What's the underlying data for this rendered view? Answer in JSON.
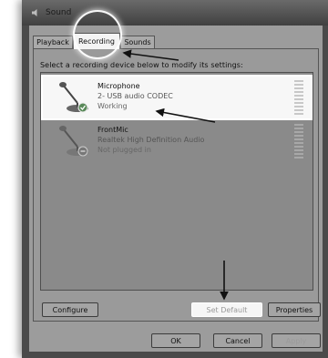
{
  "window": {
    "title": "Sound"
  },
  "tabs": [
    {
      "label": "Playback"
    },
    {
      "label": "Recording"
    },
    {
      "label": "Sounds"
    }
  ],
  "instruction": "Select a recording device below to modify its settings:",
  "devices": [
    {
      "name": "Microphone",
      "description": "2- USB audio CODEC",
      "status": "Working",
      "selected": true
    },
    {
      "name": "FrontMic",
      "description": "Realtek High Definition Audio",
      "status": "Not plugged in",
      "selected": false
    }
  ],
  "buttons": {
    "configure": "Configure",
    "set_default": "Set Default",
    "properties": "Properties",
    "ok": "OK",
    "cancel": "Cancel",
    "apply": "Apply"
  },
  "colors": {
    "highlight": "#ffffff",
    "arrow": "#111111"
  }
}
